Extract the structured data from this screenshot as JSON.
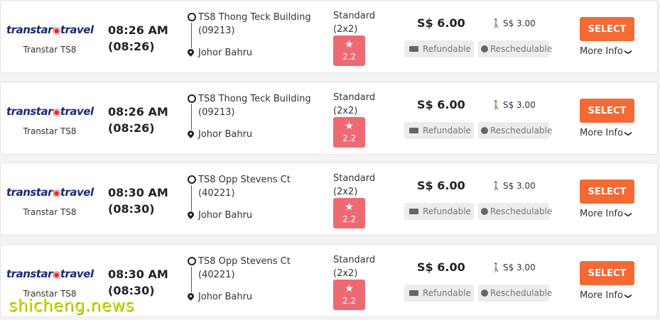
{
  "trips": [
    {
      "operator": "Transtar TS8",
      "logo_text": "transtar",
      "logo_text2": "travel",
      "departure": "08:26 AM",
      "departure_sub": "(08:26)",
      "from_stop": "TS8 Thong Teck Building",
      "from_code": "(09213)",
      "to_stop": "Johor Bahru",
      "seat_type": "Standard",
      "seat_layout": "(2x2)",
      "rating": "2.2",
      "price": "S$ 6.00",
      "per_person": "S$ 3.00",
      "refundable": "Refundable",
      "reschedulable": "Reschedulable",
      "select_label": "SELECT",
      "more_info": "More Info"
    },
    {
      "operator": "Transtar TS8",
      "logo_text": "transtar",
      "logo_text2": "travel",
      "departure": "08:26 AM",
      "departure_sub": "(08:26)",
      "from_stop": "TS8 Thong Teck Building",
      "from_code": "(09213)",
      "to_stop": "Johor Bahru",
      "seat_type": "Standard",
      "seat_layout": "(2x2)",
      "rating": "2.2",
      "price": "S$ 6.00",
      "per_person": "S$ 3.00",
      "refundable": "Refundable",
      "reschedulable": "Reschedulable",
      "select_label": "SELECT",
      "more_info": "More Info"
    },
    {
      "operator": "Transtar TS8",
      "logo_text": "transtar",
      "logo_text2": "travel",
      "departure": "08:30 AM",
      "departure_sub": "(08:30)",
      "from_stop": "TS8 Opp Stevens Ct",
      "from_code": "(40221)",
      "to_stop": "Johor Bahru",
      "seat_type": "Standard",
      "seat_layout": "(2x2)",
      "rating": "2.2",
      "price": "S$ 6.00",
      "per_person": "S$ 3.00",
      "refundable": "Refundable",
      "reschedulable": "Reschedulable",
      "select_label": "SELECT",
      "more_info": "More Info"
    },
    {
      "operator": "Transtar TS8",
      "logo_text": "transtar",
      "logo_text2": "travel",
      "departure": "08:30 AM",
      "departure_sub": "(08:30)",
      "from_stop": "TS8 Opp Stevens Ct",
      "from_code": "(40221)",
      "to_stop": "Johor Bahru",
      "seat_type": "Standard",
      "seat_layout": "(2x2)",
      "rating": "2.2",
      "price": "S$ 6.00",
      "per_person": "S$ 3.00",
      "refundable": "Refundable",
      "reschedulable": "Reschedulable",
      "select_label": "SELECT",
      "more_info": "More Info"
    }
  ],
  "watermark": "shicheng.news",
  "icons": {
    "origin": "origin-circle-icon",
    "destination": "location-pin-icon",
    "rating": "star-icon",
    "person": "person-icon",
    "refundable": "ticket-icon",
    "reschedulable": "clock-icon",
    "more": "chevron-down-icon"
  },
  "colors": {
    "select_button": "#f36a35",
    "rating_badge": "#ee6a73",
    "logo_blue": "#1b2a7a",
    "logo_red": "#e32525",
    "watermark": "#d8e82a"
  }
}
